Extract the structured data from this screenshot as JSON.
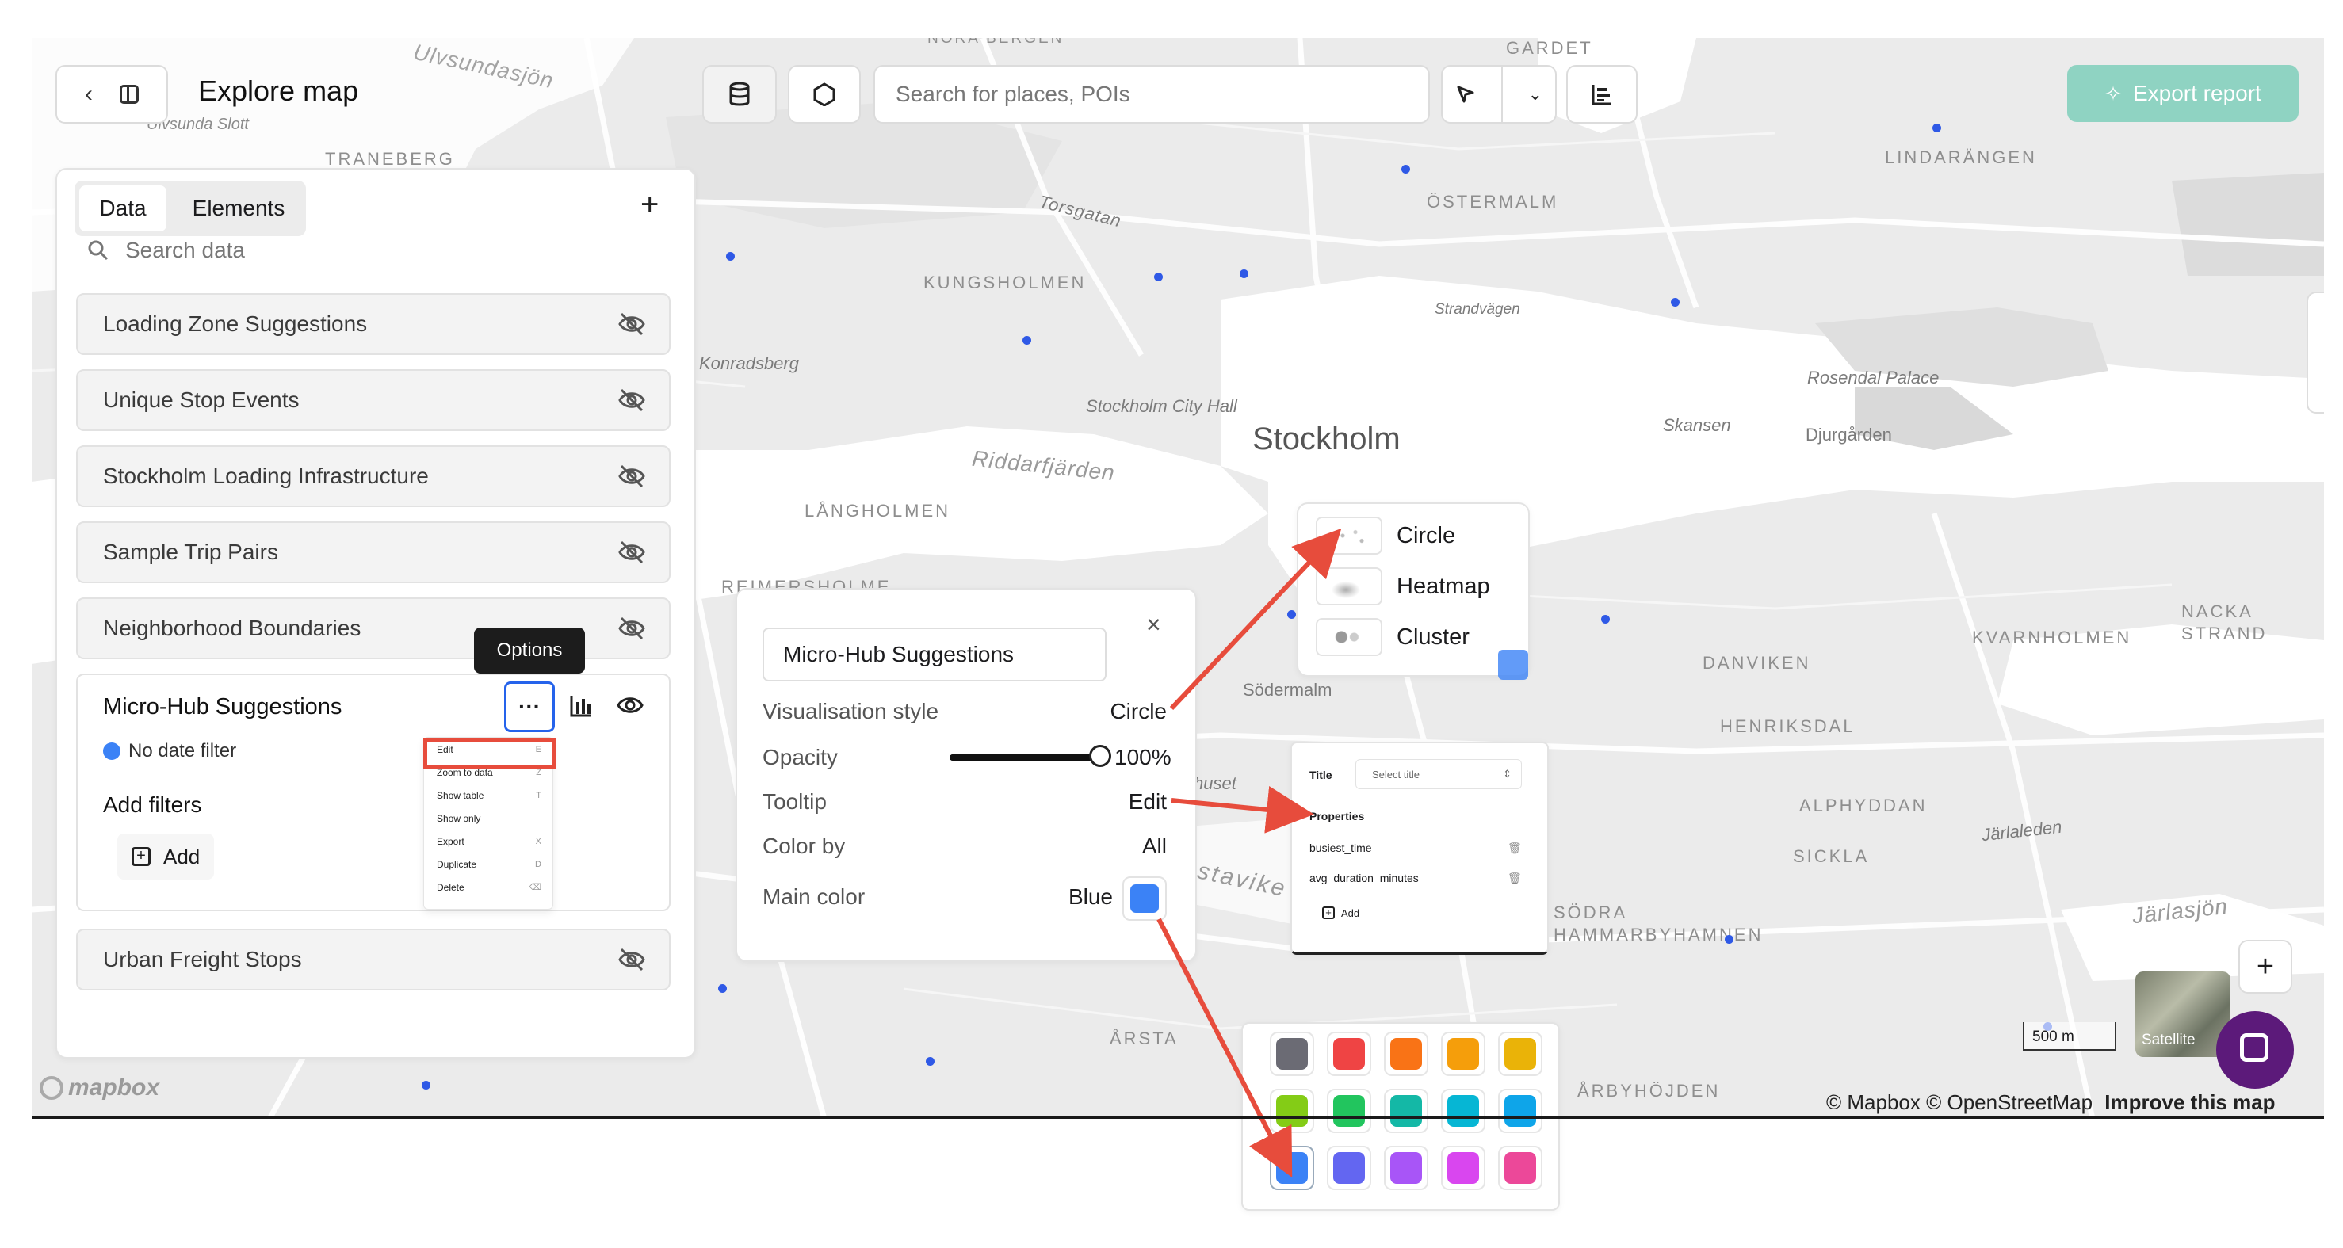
{
  "header": {
    "title": "Explore map",
    "search_placeholder": "Search for places, POIs",
    "export_label": "Export report"
  },
  "sidebar": {
    "tabs": [
      "Data",
      "Elements"
    ],
    "search_placeholder": "Search data",
    "layers": [
      "Loading Zone Suggestions",
      "Unique Stop Events",
      "Stockholm Loading Infrastructure",
      "Sample Trip Pairs",
      "Neighborhood Boundaries"
    ],
    "active_layer": {
      "name": "Micro-Hub Suggestions",
      "date_filter": "No date filter",
      "add_filters": "Add filters",
      "add_label": "Add"
    },
    "last_layer": "Urban Freight Stops",
    "options_tooltip": "Options"
  },
  "context_menu": [
    {
      "label": "Edit",
      "key": "E"
    },
    {
      "label": "Zoom to data",
      "key": "Z"
    },
    {
      "label": "Show table",
      "key": "T"
    },
    {
      "label": "Show only",
      "key": ""
    },
    {
      "label": "Export",
      "key": "X"
    },
    {
      "label": "Duplicate",
      "key": "D"
    },
    {
      "label": "Delete",
      "key": "⌫"
    }
  ],
  "edit_panel": {
    "name_value": "Micro-Hub Suggestions",
    "rows": {
      "vis_label": "Visualisation style",
      "vis_value": "Circle",
      "opacity_label": "Opacity",
      "opacity_value": "100%",
      "tooltip_label": "Tooltip",
      "tooltip_value": "Edit",
      "colorby_label": "Color by",
      "colorby_value": "All",
      "maincolor_label": "Main color",
      "maincolor_value": "Blue"
    },
    "opacity_fraction": 1.0,
    "main_color": "#3b82f6"
  },
  "style_popup": [
    "Circle",
    "Heatmap",
    "Cluster"
  ],
  "tooltip_popup": {
    "title_label": "Title",
    "title_select": "Select title",
    "properties_label": "Properties",
    "properties": [
      "busiest_time",
      "avg_duration_minutes"
    ],
    "add_label": "Add"
  },
  "palette": {
    "colors": [
      "#6b6b74",
      "#ef4444",
      "#f97316",
      "#f59e0b",
      "#eab308",
      "#84cc16",
      "#22c55e",
      "#14b8a6",
      "#06b6d4",
      "#0ea5e9",
      "#3b82f6",
      "#6366f1",
      "#a855f7",
      "#d946ef",
      "#ec4899"
    ],
    "selected": "#3b82f6"
  },
  "map": {
    "labels": {
      "ulvsundasjon": "Ulvsundasjön",
      "ulvsunda_slott": "Ulvsunda Slott",
      "traneberg": "TRANEBERG",
      "nora_bergen": "NORA BERGEN",
      "gardet": "GARDET",
      "lindarangen": "LINDARÄNGEN",
      "ostermalm": "ÖSTERMALM",
      "torsgatan": "Torsgatan",
      "kungsholmen": "KUNGSHOLMEN",
      "strandvagen": "Strandvägen",
      "konradsberg": "Konradsberg",
      "rosendal": "Rosendal Palace",
      "city_hall": "Stockholm City Hall",
      "stockholm": "Stockholm",
      "skansen": "Skansen",
      "djurgarden": "Djurgården",
      "riddarfjarden": "Riddarfjärden",
      "langholmen": "LÅNGHOLMEN",
      "reimersholme": "REIMERSHOLME",
      "sodermalm": "Södermalm",
      "danviken": "DANVIKEN",
      "kvarnholmen": "KVARNHOLMEN",
      "nacka_strand": "NACKA STRAND",
      "henriksdal": "HENRIKSDAL",
      "alphyddan": "ALPHYDDAN",
      "jarlaleden": "Järlaleden",
      "sickla": "SICKLA",
      "sodra_hammarby": "SÖDRA HAMMARBYHAMNEN",
      "jarlasjon": "Järlasjön",
      "arsta": "ÅRSTA",
      "arbyhojden": "ÅRBYHÖJDEN",
      "ostaviken": "stavike",
      "huset": "huset"
    },
    "scale": "500 m",
    "satellite": "Satellite",
    "attribution": "© Mapbox © OpenStreetMap",
    "improve": "Improve this map",
    "mapbox_logo": "mapbox"
  }
}
